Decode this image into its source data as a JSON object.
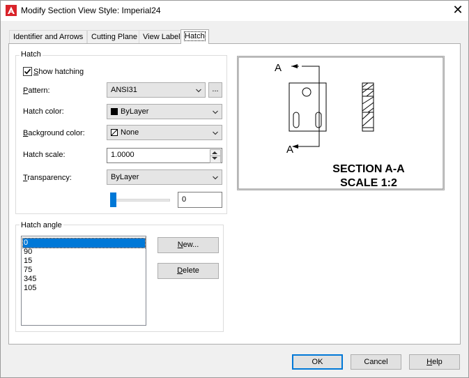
{
  "window": {
    "title": "Modify Section View Style: Imperial24",
    "close_glyph": "✕"
  },
  "tabs": [
    {
      "label": "Identifier and Arrows"
    },
    {
      "label": "Cutting Plane"
    },
    {
      "label": "View Label"
    },
    {
      "label": "Hatch"
    }
  ],
  "hatch_group": {
    "label": "Hatch",
    "show_hatching": {
      "label_pre": "",
      "label_u": "S",
      "label_post": "how hatching",
      "checked": true
    },
    "pattern": {
      "label_u": "P",
      "label_post": "attern:",
      "value": "ANSI31",
      "browse": "..."
    },
    "hatch_color": {
      "label": "Hatch color:",
      "value": "ByLayer",
      "swatch": "#000000"
    },
    "background_color": {
      "label_u": "B",
      "label_post": "ackground color:",
      "value": "None"
    },
    "hatch_scale": {
      "label": "Hatch scale:",
      "value": "1.0000"
    },
    "transparency": {
      "label_u": "T",
      "label_post": "ransparency:",
      "value": "ByLayer",
      "slider_value": "0",
      "slider_fraction": 0
    }
  },
  "hatch_angle": {
    "label": "Hatch angle",
    "items": [
      "0",
      "90",
      "15",
      "75",
      "345",
      "105"
    ],
    "selected_index": 0,
    "new_button": {
      "label_u": "N",
      "label_post": "ew..."
    },
    "delete_button": {
      "label_u": "D",
      "label_post": "elete"
    }
  },
  "preview": {
    "arrow_label_top": "A",
    "arrow_label_bottom": "A",
    "caption_line1": "SECTION A-A",
    "caption_line2": "SCALE 1:2"
  },
  "footer": {
    "ok": "OK",
    "cancel": "Cancel",
    "help_u": "H",
    "help_post": "elp"
  }
}
